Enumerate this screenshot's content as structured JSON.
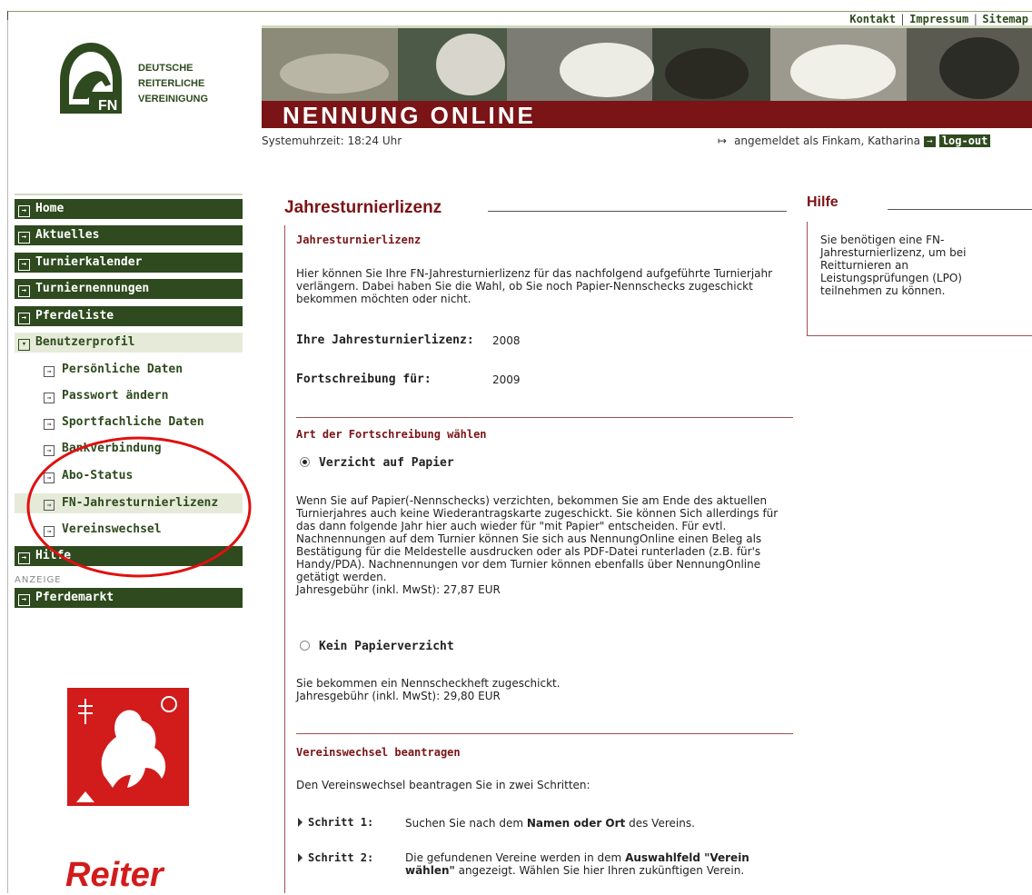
{
  "top_links": [
    "Kontakt",
    "Impressum",
    "Sitemap"
  ],
  "logo": {
    "line1": "DEUTSCHE",
    "line2": "REITERLICHE",
    "line3": "VEREINIGUNG",
    "badge": "FN"
  },
  "header": {
    "title": "NENNUNG ONLINE"
  },
  "system_time": "Systemuhrzeit: 18:24 Uhr",
  "login": {
    "text": "angemeldet als Finkam, Katharina",
    "logout_label": "log-out"
  },
  "nav": {
    "main": [
      {
        "label": "Home"
      },
      {
        "label": "Aktuelles"
      },
      {
        "label": "Turnierkalender"
      },
      {
        "label": "Turniernennungen"
      },
      {
        "label": "Pferdeliste"
      },
      {
        "label": "Benutzerprofil"
      }
    ],
    "sub": [
      {
        "label": "Persönliche Daten"
      },
      {
        "label": "Passwort ändern"
      },
      {
        "label": "Sportfachliche Daten"
      },
      {
        "label": "Bankverbindung"
      },
      {
        "label": "Abo-Status"
      },
      {
        "label": "FN-Jahresturnierlizenz"
      },
      {
        "label": "Vereinswechsel"
      }
    ],
    "hilfe": "Hilfe",
    "anzeige": "ANZEIGE",
    "pferdemarkt": "Pferdemarkt"
  },
  "ad": {
    "reiter": "Reiter"
  },
  "main": {
    "title": "Jahresturnierlizenz",
    "section1_head": "Jahresturnierlizenz",
    "section1_text": "Hier können Sie Ihre FN-Jahresturnierlizenz für das nachfolgend aufgeführte Turnierjahr verlängern. Dabei haben Sie die Wahl, ob Sie noch Papier-Nennschecks zugeschickt bekommen möchten oder nicht.",
    "lizenz_label": "Ihre Jahresturnierlizenz:",
    "lizenz_value": "2008",
    "fortschreibung_label": "Fortschreibung für:",
    "fortschreibung_value": "2009",
    "section2_head": "Art der Fortschreibung wählen",
    "option1_label": "Verzicht auf Papier",
    "option1_text": "Wenn Sie auf Papier(-Nennschecks) verzichten, bekommen Sie am Ende des aktuellen Turnierjahres auch keine Wiederantragskarte zugeschickt. Sie können Sich allerdings für das dann folgende Jahr hier auch wieder für \"mit Papier\" entscheiden. Für evtl. Nachnennungen auf dem Turnier können Sie sich aus NennungOnline einen Beleg als Bestätigung für die Meldestelle ausdrucken oder als PDF-Datei runterladen (z.B. für's Handy/PDA). Nachnennungen vor dem Turnier können ebenfalls über NennungOnline getätigt werden.",
    "option1_fee": "Jahresgebühr (inkl. MwSt): 27,87 EUR",
    "option2_label": "Kein Papierverzicht",
    "option2_text": "Sie bekommen ein Nennscheckheft zugeschickt.",
    "option2_fee": "Jahresgebühr (inkl. MwSt): 29,80 EUR",
    "section3_head": "Vereinswechsel beantragen",
    "section3_text": "Den Vereinswechsel beantragen Sie in zwei Schritten:",
    "step1_label": "Schritt 1:",
    "step1_a": "Suchen Sie nach dem ",
    "step1_b": "Namen oder Ort",
    "step1_c": " des Vereins.",
    "step2_label": "Schritt 2:",
    "step2_a": "Die gefundenen Vereine werden in dem ",
    "step2_b": "Auswahlfeld \"Verein wählen\"",
    "step2_c": " angezeigt. Wählen Sie hier Ihren zukünftigen Verein."
  },
  "help": {
    "title": "Hilfe",
    "text": "Sie benötigen eine FN-Jahresturnierlizenz, um bei Reitturnieren an Leistungsprüfungen (LPO) teilnehmen zu können."
  },
  "colors": {
    "nav_green": "#2e4a1e",
    "brand_red": "#7a1416",
    "annotation_red": "#e01010"
  }
}
